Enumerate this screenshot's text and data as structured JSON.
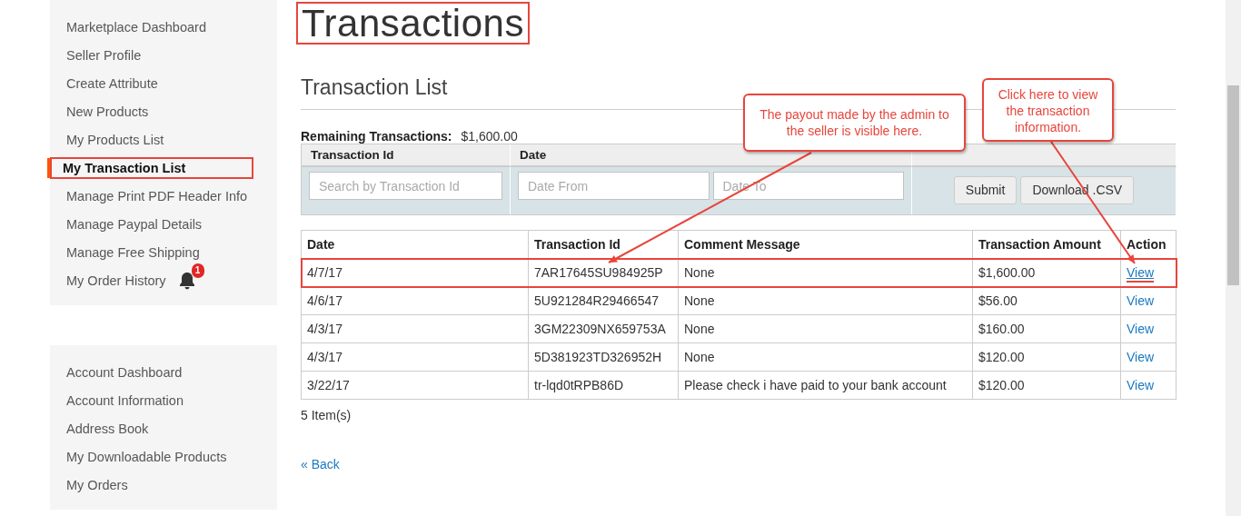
{
  "sidebar": {
    "groups": [
      {
        "items": [
          {
            "label": "Marketplace Dashboard",
            "selected": false,
            "highlighted": false
          },
          {
            "label": "Seller Profile",
            "selected": false,
            "highlighted": false
          },
          {
            "label": "Create Attribute",
            "selected": false,
            "highlighted": false
          },
          {
            "label": "New Products",
            "selected": false,
            "highlighted": false
          },
          {
            "label": "My Products List",
            "selected": false,
            "highlighted": false
          },
          {
            "label": "My Transaction List",
            "selected": true,
            "highlighted": true
          },
          {
            "label": "Manage Print PDF Header Info",
            "selected": false,
            "highlighted": false
          },
          {
            "label": "Manage Paypal Details",
            "selected": false,
            "highlighted": false
          },
          {
            "label": "Manage Free Shipping",
            "selected": false,
            "highlighted": false
          },
          {
            "label": "My Order History",
            "selected": false,
            "highlighted": false,
            "badge": "1"
          }
        ]
      },
      {
        "items": [
          {
            "label": "Account Dashboard",
            "selected": false,
            "highlighted": false
          },
          {
            "label": "Account Information",
            "selected": false,
            "highlighted": false
          },
          {
            "label": "Address Book",
            "selected": false,
            "highlighted": false
          },
          {
            "label": "My Downloadable Products",
            "selected": false,
            "highlighted": false
          },
          {
            "label": "My Orders",
            "selected": false,
            "highlighted": false
          }
        ]
      }
    ]
  },
  "page_title": {
    "text": "Transactions",
    "highlighted": true
  },
  "section_title": "Transaction List",
  "remaining": {
    "label": "Remaining Transactions:",
    "value": "$1,600.00"
  },
  "filter": {
    "columns": [
      "Transaction Id",
      "Date"
    ],
    "search_placeholder": "Search by Transaction Id",
    "date_from_placeholder": "Date From",
    "date_to_placeholder": "Date To",
    "buttons": [
      "Submit",
      "Download .CSV"
    ]
  },
  "table": {
    "columns": [
      "Date",
      "Transaction Id",
      "Comment Message",
      "Transaction Amount",
      "Action"
    ],
    "rows": [
      {
        "cells": [
          "4/7/17",
          "7AR17645SU984925P",
          "None",
          "$1,600.00"
        ],
        "action": "View",
        "highlighted": true
      },
      {
        "cells": [
          "4/6/17",
          "5U921284R29466547",
          "None",
          "$56.00"
        ],
        "action": "View",
        "highlighted": false
      },
      {
        "cells": [
          "4/3/17",
          "3GM22309NX659753A",
          "None",
          "$160.00"
        ],
        "action": "View",
        "highlighted": false
      },
      {
        "cells": [
          "4/3/17",
          "5D381923TD326952H",
          "None",
          "$120.00"
        ],
        "action": "View",
        "highlighted": false
      },
      {
        "cells": [
          "3/22/17",
          "tr-lqd0tRPB86D",
          "Please check i have paid to your bank account",
          "$120.00"
        ],
        "action": "View",
        "highlighted": false
      }
    ]
  },
  "item_count": "5 Item(s)",
  "back_link": "« Back",
  "annotations": [
    {
      "text": "The payout made by the admin to the seller is visible here."
    },
    {
      "text": "Click here to view the transaction information."
    }
  ]
}
